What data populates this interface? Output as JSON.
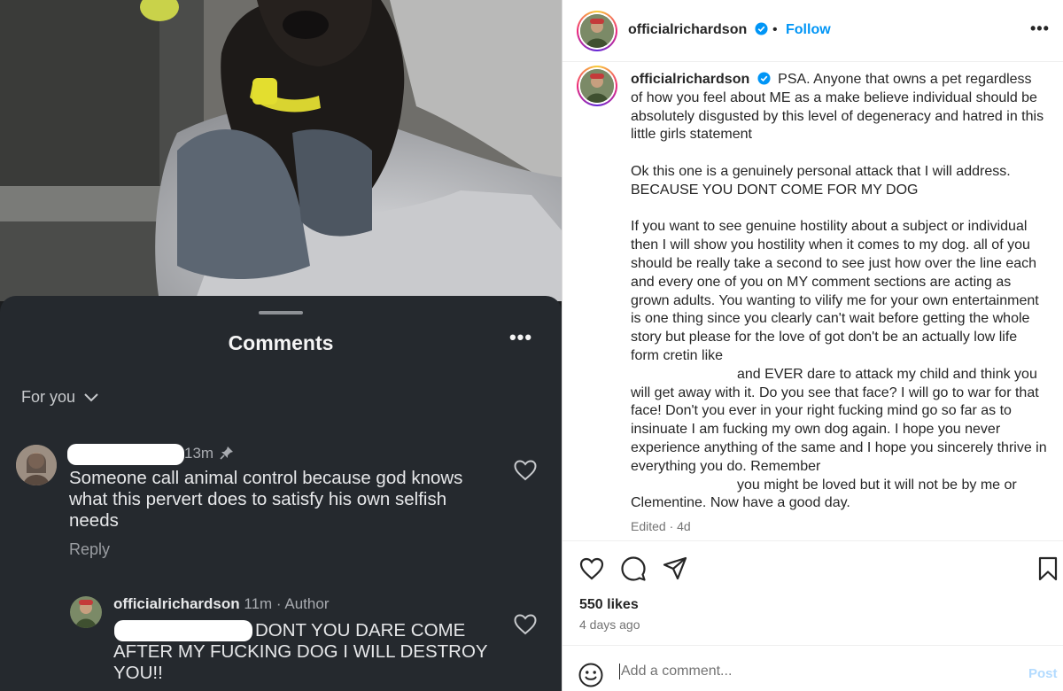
{
  "comments_sheet": {
    "title": "Comments",
    "more_icon": "more-horizontal-icon",
    "filter_label": "For you",
    "comments": [
      {
        "time": "13m",
        "text": "Someone call animal control because god knows what this pervert does to satisfy his own selfish needs",
        "reply_label": "Reply"
      },
      {
        "username": "officialrichardson",
        "time": "11m",
        "role": "Author",
        "text": "DONT YOU DARE COME AFTER MY FUCKING DOG I WILL DESTROY YOU!!"
      }
    ]
  },
  "post": {
    "header": {
      "username": "officialrichardson",
      "separator": "•",
      "follow_label": "Follow",
      "more_icon": "more-horizontal-icon"
    },
    "caption": {
      "username": "officialrichardson",
      "p1": "PSA. Anyone that owns a pet regardless of how you feel about ME as a make believe individual should be absolutely disgusted by this level of degeneracy and hatred in this little girls statement",
      "p2": "Ok this one is a genuinely personal attack that I will address. BECAUSE YOU DONT COME FOR MY DOG",
      "p3a": "If you want to see genuine hostility about a subject or individual then I will show you hostility when it comes to my dog. all of you should be really take a second to see just how over the line each and every one of you on MY comment sections are acting as grown adults. You wanting to vilify me for your own entertainment is one thing since you clearly can't wait before getting the whole story but please for the love of got don't be an actually low life form cretin like",
      "p3b": "and EVER dare to attack my child and think you will get away with it. Do you see that face? I will go to war for that face! Don't you ever in your right fucking mind go so far as to insinuate I am fucking my own dog again. I hope you never experience anything of the same and I hope you sincerely thrive in everything you do. Remember",
      "p3c": "you might be loved but it will not be by me or Clementine. Now have a good day.",
      "edited": "Edited · 4d"
    },
    "likes": "550 likes",
    "posted_ago": "4 days ago",
    "add_comment_placeholder": "Add a comment...",
    "post_label": "Post"
  },
  "colors": {
    "sheet_bg": "#25292e",
    "follow_blue": "#0095f6",
    "verified_blue": "#0095f6"
  }
}
